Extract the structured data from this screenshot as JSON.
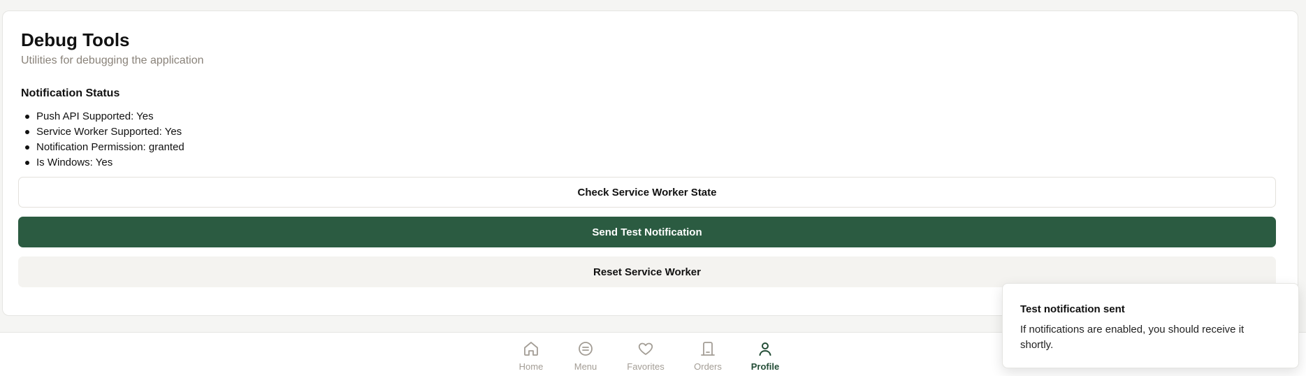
{
  "card": {
    "title": "Debug Tools",
    "subtitle": "Utilities for debugging the application",
    "section_title": "Notification Status",
    "status_items": [
      "Push API Supported: Yes",
      "Service Worker Supported: Yes",
      "Notification Permission: granted",
      "Is Windows: Yes"
    ]
  },
  "buttons": {
    "check_label": "Check Service Worker State",
    "send_label": "Send Test Notification",
    "reset_label": "Reset Service Worker"
  },
  "nav": {
    "items": [
      {
        "label": "Home",
        "icon": "home-icon",
        "active": false
      },
      {
        "label": "Menu",
        "icon": "menu-icon",
        "active": false
      },
      {
        "label": "Favorites",
        "icon": "heart-icon",
        "active": false
      },
      {
        "label": "Orders",
        "icon": "receipt-icon",
        "active": false
      },
      {
        "label": "Profile",
        "icon": "user-icon",
        "active": true
      }
    ]
  },
  "toast": {
    "title": "Test notification sent",
    "description": "If notifications are enabled, you should receive it shortly."
  },
  "colors": {
    "primary": "#2b5b41",
    "nav_active": "#234d36",
    "nav_inactive": "#a39d95",
    "subtitle": "#8a837a",
    "background": "#f5f5f3"
  }
}
